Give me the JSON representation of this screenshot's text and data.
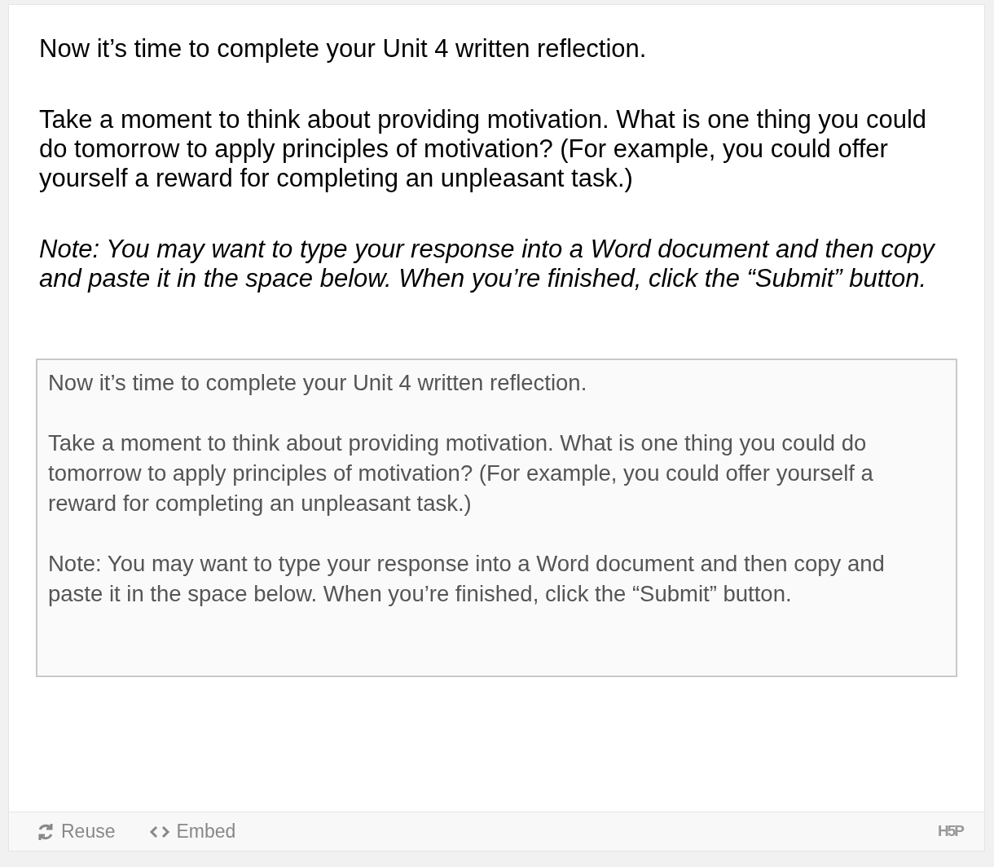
{
  "paragraphs": [
    {
      "kind": "plain",
      "text": "Now it’s time to complete your Unit 4 written reflection."
    },
    {
      "kind": "plain",
      "text": "Take a moment to think about providing motivation. What is one thing you could do tomorrow to apply principles of motivation? (For example, you could offer yourself a reward for completing an unpleasant task.)"
    },
    {
      "kind": "italic",
      "text": "Note: You may want to type your response into a Word document and then copy and paste it in the space below. When you’re finished, click the “Submit” button."
    }
  ],
  "answer": {
    "placeholder": "Now it’s time to complete your Unit 4 written reflection.\n\nTake a moment to think about providing motivation. What is one thing you could do tomorrow to apply principles of motivation? (For example, you could offer yourself a reward for completing an unpleasant task.)\n\nNote: You may want to type your response into a Word document and then copy and paste it in the space below. When you’re finished, click the “Submit” button."
  },
  "footer": {
    "actions": [
      {
        "kind": "reuse",
        "label": "Reuse"
      },
      {
        "kind": "embed",
        "label": "Embed"
      }
    ],
    "logo": "H5P"
  }
}
